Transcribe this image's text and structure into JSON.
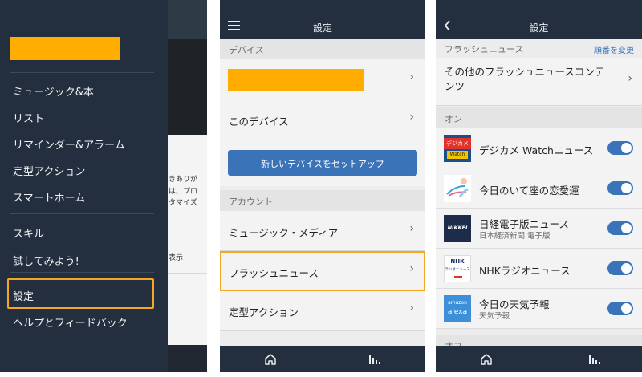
{
  "panel1": {
    "menu": [
      {
        "label": "ミュージック&本"
      },
      {
        "label": "リスト"
      },
      {
        "label": "リマインダー&アラーム"
      },
      {
        "label": "定型アクション"
      },
      {
        "label": "スマートホーム"
      },
      {
        "label": "スキル"
      },
      {
        "label": "試してみよう!"
      },
      {
        "label": "設定"
      },
      {
        "label": "ヘルプとフィードバック"
      }
    ],
    "background_text": [
      "きありが",
      "は、プロ",
      "タマイズ",
      "表示"
    ],
    "colors": {
      "drawer": "#232f3e",
      "highlight": "#f5a623",
      "logo_redaction": "#ffad00"
    }
  },
  "panel2": {
    "title": "設定",
    "device_header": "デバイス",
    "this_device": "このデバイス",
    "setup_button": "新しいデバイスをセットアップ",
    "account_header": "アカウント",
    "music_media": "ミュージック・メディア",
    "flash_news": "フラッシュニュース",
    "routines": "定型アクション",
    "colors": {
      "topbar": "#232f3e",
      "button": "#3a73b8",
      "highlight": "#f5a623"
    }
  },
  "panel3": {
    "title": "設定",
    "section_header": "フラッシュニュース",
    "reorder_link": "順番を変更",
    "other_content": "その他のフラッシュニュースコンテンツ",
    "on_header": "オン",
    "off_header": "オフ",
    "feeds": [
      {
        "name": "デジカメ Watchニュース",
        "subtitle": "",
        "icon": "digicame-watch-icon",
        "enabled": true
      },
      {
        "name": "今日のいて座の恋愛運",
        "subtitle": "",
        "icon": "sagittarius-icon",
        "enabled": true
      },
      {
        "name": "日経電子版ニュース",
        "subtitle": "日本経済新聞 電子版",
        "icon": "nikkei-icon",
        "enabled": true
      },
      {
        "name": "NHKラジオニュース",
        "subtitle": "",
        "icon": "nhk-radio-icon",
        "enabled": true
      },
      {
        "name": "今日の天気予報",
        "subtitle": "天気予報",
        "icon": "amazon-alexa-icon",
        "enabled": true
      }
    ],
    "icon_text": {
      "digicame_top": "デジカメ",
      "digicame_bottom": "Watch",
      "nikkei": "NIKKEI",
      "nhk_top": "NHK",
      "nhk_bottom": "ラジオニュース",
      "amazon": "amazon",
      "alexa": "alexa"
    },
    "colors": {
      "toggle_on": "#3a73b8",
      "link": "#3a73b8"
    }
  }
}
